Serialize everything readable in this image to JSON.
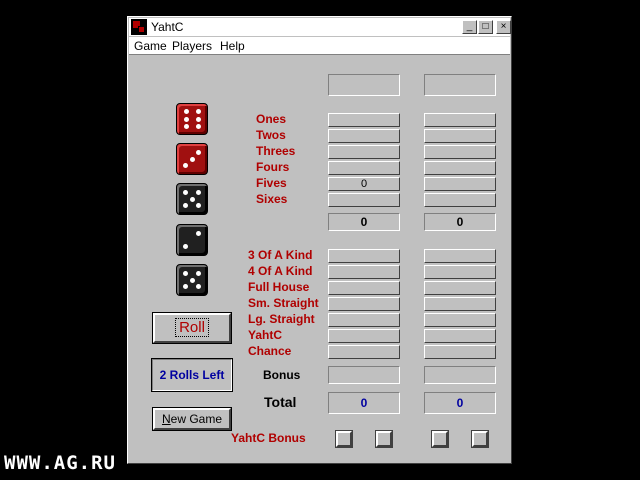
{
  "window": {
    "title": "YahtC",
    "controls": {
      "minimize": "_",
      "maximize": "□",
      "close": "×"
    }
  },
  "menu": {
    "game": "Game",
    "players": "Players",
    "help": "Help"
  },
  "dice": [
    {
      "color": "red",
      "value": 6
    },
    {
      "color": "red",
      "value": 3
    },
    {
      "color": "black",
      "value": 5
    },
    {
      "color": "black",
      "value": 2
    },
    {
      "color": "black",
      "value": 5
    }
  ],
  "upper_section": {
    "labels": [
      "Ones",
      "Twos",
      "Threes",
      "Fours",
      "Fives",
      "Sixes"
    ],
    "player1": [
      "",
      "",
      "",
      "",
      "0",
      ""
    ],
    "player2": [
      "",
      "",
      "",
      "",
      "",
      ""
    ],
    "subtotal": [
      "0",
      "0"
    ]
  },
  "lower_section": {
    "labels": [
      "3 Of A Kind",
      "4 Of A Kind",
      "Full House",
      "Sm. Straight",
      "Lg. Straight",
      "YahtC",
      "Chance"
    ],
    "player1": [
      "",
      "",
      "",
      "",
      "",
      "",
      ""
    ],
    "player2": [
      "",
      "",
      "",
      "",
      "",
      "",
      ""
    ]
  },
  "bonus": {
    "label": "Bonus",
    "values": [
      "",
      ""
    ]
  },
  "total": {
    "label": "Total",
    "values": [
      "0",
      "0"
    ]
  },
  "yahtc_bonus": {
    "label": "YahtC Bonus"
  },
  "buttons": {
    "roll": "Roll",
    "rolls_left": "2 Rolls Left",
    "new_game_first": "N",
    "new_game_rest": "ew Game"
  },
  "watermark": "WWW.AG.RU",
  "colors": {
    "accent_red": "#b00000",
    "accent_blue": "#0000a0",
    "face": "#c0c0c0"
  }
}
